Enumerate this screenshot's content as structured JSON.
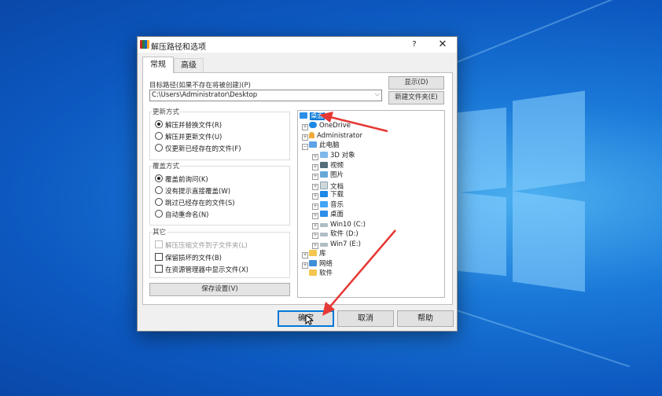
{
  "dialog": {
    "title": "解压路径和选项",
    "help": "?",
    "close": "✕"
  },
  "tabs": [
    {
      "label": "常规",
      "active": true
    },
    {
      "label": "高级",
      "active": false
    }
  ],
  "target": {
    "label": "目标路径(如果不存在将被创建)(P)",
    "value": "C:\\Users\\Administrator\\Desktop",
    "show_button": "显示(D)",
    "new_folder_button": "新建文件夹(E)"
  },
  "update_mode": {
    "title": "更新方式",
    "options": [
      {
        "label": "解压并替换文件(R)",
        "selected": true
      },
      {
        "label": "解压并更新文件(U)",
        "selected": false
      },
      {
        "label": "仅更新已经存在的文件(F)",
        "selected": false
      }
    ]
  },
  "overwrite_mode": {
    "title": "覆盖方式",
    "options": [
      {
        "label": "覆盖前询问(K)",
        "selected": true
      },
      {
        "label": "没有提示直接覆盖(W)",
        "selected": false
      },
      {
        "label": "跳过已经存在的文件(S)",
        "selected": false
      },
      {
        "label": "自动重命名(N)",
        "selected": false
      }
    ]
  },
  "misc": {
    "title": "其它",
    "options": [
      {
        "label": "解压压缩文件到子文件夹(L)",
        "checked": false,
        "disabled": true
      },
      {
        "label": "保留损坏的文件(B)",
        "checked": false,
        "disabled": false
      },
      {
        "label": "在资源管理器中显示文件(X)",
        "checked": false,
        "disabled": false
      }
    ]
  },
  "save_settings": "保存设置(V)",
  "tree": [
    {
      "label": "桌面",
      "icon": "desktop-icon",
      "selected": true
    },
    {
      "label": "OneDrive",
      "icon": "onedrive-icon"
    },
    {
      "label": "Administrator",
      "icon": "user-icon"
    },
    {
      "label": "此电脑",
      "icon": "computer-icon"
    },
    {
      "label": "3D 对象",
      "icon": "3d-objects-icon"
    },
    {
      "label": "视频",
      "icon": "video-icon"
    },
    {
      "label": "图片",
      "icon": "pictures-icon"
    },
    {
      "label": "文档",
      "icon": "documents-icon"
    },
    {
      "label": "下载",
      "icon": "download-icon"
    },
    {
      "label": "音乐",
      "icon": "music-icon"
    },
    {
      "label": "桌面",
      "icon": "desktop-icon"
    },
    {
      "label": "Win10 (C:)",
      "icon": "drive-icon"
    },
    {
      "label": "软件 (D:)",
      "icon": "drive-icon"
    },
    {
      "label": "Win7 (E:)",
      "icon": "drive-icon"
    },
    {
      "label": "库",
      "icon": "library-icon"
    },
    {
      "label": "网络",
      "icon": "network-icon"
    },
    {
      "label": "软件",
      "icon": "folder-icon"
    }
  ],
  "footer": {
    "ok": "确定",
    "cancel": "取消",
    "help": "帮助"
  },
  "colors": {
    "selection": "#0078d7",
    "annotation_arrow": "#e53935"
  }
}
